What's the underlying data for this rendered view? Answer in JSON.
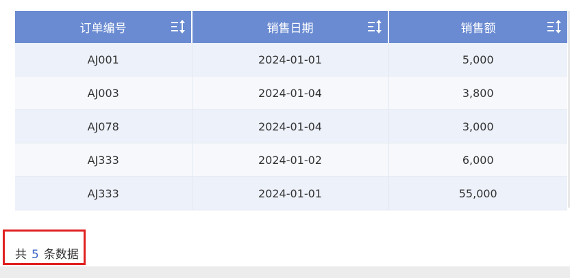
{
  "table": {
    "columns": [
      {
        "label": "订单编号",
        "sort_icon": "sort-icon"
      },
      {
        "label": "销售日期",
        "sort_icon": "sort-icon"
      },
      {
        "label": "销售额",
        "sort_icon": "sort-icon"
      }
    ],
    "rows": [
      {
        "order_id": "AJ001",
        "date": "2024-01-01",
        "amount": "5,000"
      },
      {
        "order_id": "AJ003",
        "date": "2024-01-04",
        "amount": "3,800"
      },
      {
        "order_id": "AJ078",
        "date": "2024-01-04",
        "amount": "3,000"
      },
      {
        "order_id": "AJ333",
        "date": "2024-01-02",
        "amount": "6,000"
      },
      {
        "order_id": "AJ333",
        "date": "2024-01-01",
        "amount": "55,000"
      }
    ]
  },
  "footer": {
    "prefix": "共",
    "count": "5",
    "suffix": "条数据"
  },
  "colors": {
    "header_bg": "#6a8bd2",
    "row_odd": "#edf1fa",
    "row_even": "#f6f8fc",
    "highlight_border": "#e02020",
    "count_color": "#3a63c4"
  }
}
